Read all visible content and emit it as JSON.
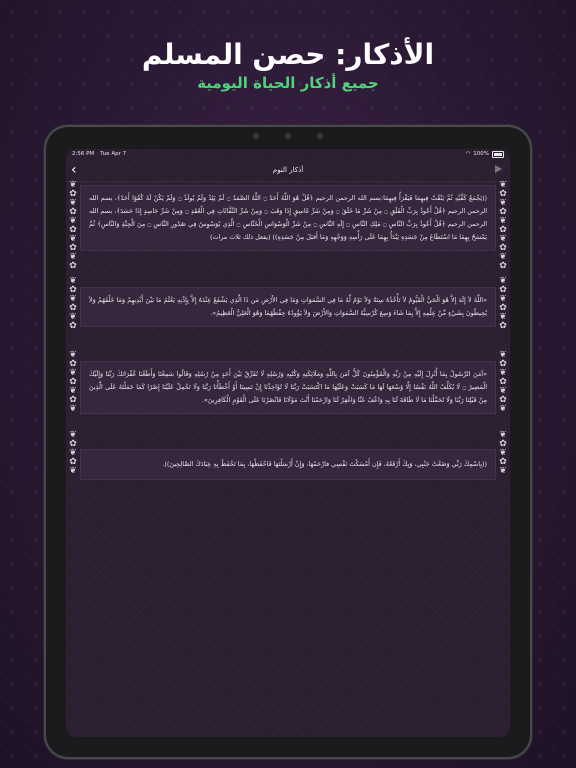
{
  "promo": {
    "headline": "الأذكار: حصن المسلم",
    "subheadline": "جميع أذكار الحياة اليومية"
  },
  "status_bar": {
    "time": "2:56 PM",
    "date": "Tue Apr 7",
    "battery": "100%"
  },
  "nav": {
    "title": "أذكار النوم",
    "back_icon": "chevron-left-icon",
    "play_icon": "play-icon"
  },
  "cards": [
    {
      "text": "((يَجْمَعُ كَفَّيْهِ ثُمَّ يَنْفُثُ فِيهِمَا فَيَقْرَأُ فِيهِمَا:بسم الله الرحمن الرحيم ﴿قُلْ هُوَ اللَّهُ أَحَدٌ ۝ اللَّهُ الصَّمَدُ ۝ لَمْ يَلِدْ وَلَمْ يُولَدْ ۝ وَلَمْ يَكُنْ لَهُ كُفُوًا أَحَدٌ﴾، بسم الله الرحمن الرحيم ﴿قُلْ أَعُوذُ بِرَبِّ الْفَلَقِ ۝ مِنْ شَرِّ مَا خَلَقَ ۝ وَمِنْ شَرِّ غَاسِقٍ إِذَا وَقَبَ ۝ وَمِنْ شَرِّ النَّفَّاثَاتِ فِي الْعُقَدِ ۝ وَمِنْ شَرِّ حَاسِدٍ إِذَا حَسَدَ﴾، بسم الله الرحمن الرحيم ﴿قُلْ أَعُوذُ بِرَبِّ النَّاسِ ۝ مَلِكِ النَّاسِ ۝ إِلَهِ النَّاسِ ۝ مِنْ شَرِّ الْوَسْوَاسِ الْخَنَّاسِ ۝ الَّذِي يُوَسْوِسُ فِي صُدُورِ النَّاسِ ۝ مِنَ الْجِنَّةِ وَالنَّاسِ﴾ ثُمَّ يَمْسَحُ بِهِمَا مَا اسْتَطَاعَ مِنْ جَسَدِهِ يَبْدَأُ بِهِمَا عَلَى رَأْسِهِ وَوَجْهِهِ وَمَا أَقبَلَ مِنْ جَسَدِهِ)) (يفعل ذلك ثلاث مرات)"
    },
    {
      "text": "«اللَّهُ لاَ إِلَهَ إِلاَّ هُوَ الْحَيُّ الْقَيُّومُ لاَ تَأْخُذُهُ سِنَةٌ وَلاَ نَوْمٌ لَّهُ مَا فِي السَّمَوَاتِ وَمَا فِي الأَرْضِ مَن ذَا الَّذِي يَشْفَعُ عِنْدَهُ إِلاَّ بِإِذْنِهِ يَعْلَمُ مَا بَيْنَ أَيْدِيهِمْ وَمَا خَلْفَهُمْ وَلاَ يُحِيطُونَ بِشَيْءٍ مِّنْ عِلْمِهِ إِلاَّ بِمَا شَاءَ وَسِعَ كُرْسِيُّهُ السَّمَوَاتِ وَالأَرْضَ وَلاَ يَؤُودُهُ حِفْظُهُمَا وَهُوَ الْعَلِيُّ الْعَظِيمُ»."
    },
    {
      "text": "«آمَنَ الرَّسُولُ بِمَا أُنْزِلَ إِلَيْهِ مِنْ رَبِّهِ وَالْمُؤْمِنُونَ كُلٌّ آمَنَ بِاللَّهِ وَمَلَائِكَتِهِ وَكُتُبِهِ وَرُسُلِهِ لَا نُفَرِّقُ بَيْنَ أَحَدٍ مِنْ رُسُلِهِ وَقَالُوا سَمِعْنَا وَأَطَعْنَا غُفْرَانَكَ رَبَّنَا وَإِلَيْكَ الْمَصِيرُ ۝ لَا يُكَلِّفُ اللَّهُ نَفْسًا إِلَّا وُسْعَهَا لَهَا مَا كَسَبَتْ وَعَلَيْهَا مَا اكْتَسَبَتْ رَبَّنَا لَا تُؤَاخِذْنَا إِنْ نَسِينَا أَوْ أَخْطَأْنَا رَبَّنَا وَلَا تَحْمِلْ عَلَيْنَا إِصْرًا كَمَا حَمَلْتَهُ عَلَى الَّذِينَ مِنْ قَبْلِنَا رَبَّنَا وَلَا تُحَمِّلْنَا مَا لَا طَاقَةَ لَنَا بِهِ وَاعْفُ عَنَّا وَاغْفِرْ لَنَا وَارْحَمْنَا أَنْتَ مَوْلَانَا فَانْصُرْنَا عَلَى الْقَوْمِ الْكَافِرِينَ»."
    },
    {
      "text": "((بِاسْمِكَ رَبِّي وَضَعْتُ جَنْبِي، وَبِكَ أَرْفَعُهُ، فَإِن أَمْسَكْتَ نَفْسِي فارْحَمْهَا، وَإِنْ أَرْسَلْتَهَا فَاحْفَظْهَا، بِمَا تَحْفَظُ بِهِ عِبَادَكَ الصَّالِحِينَ))."
    }
  ]
}
